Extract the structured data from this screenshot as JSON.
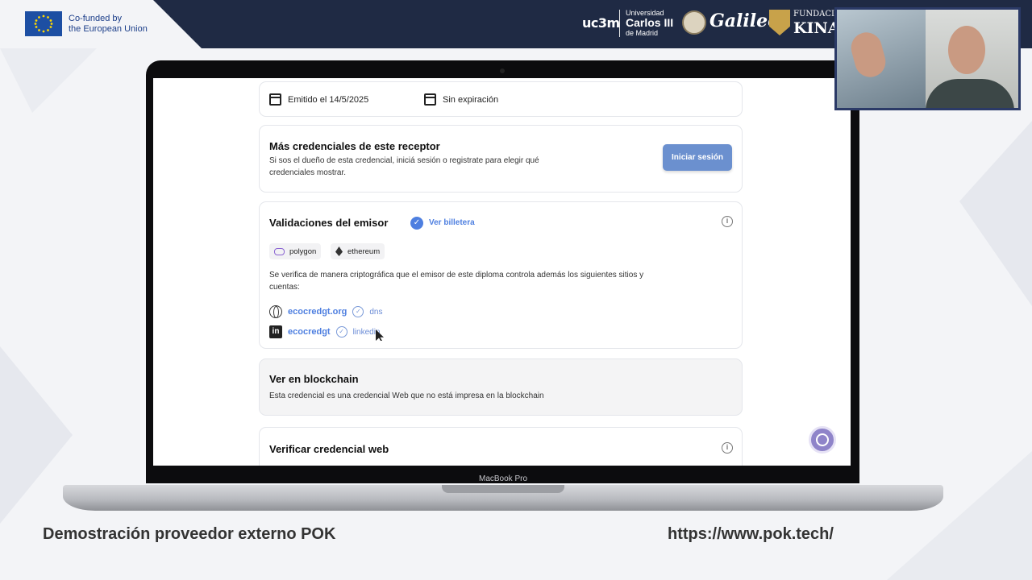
{
  "banner": {
    "eu_text_line1": "Co-funded by",
    "eu_text_line2": "the European Union",
    "uc3m_logo": "uc3m",
    "uc3m_line1": "Universidad",
    "uc3m_line2": "Carlos III",
    "uc3m_line3": "de Madrid",
    "galileo": "Galileo",
    "kinal_line1": "FUNDACIÓ",
    "kinal_line2": "KINAL",
    "colors": {
      "banner": "#1f2a44",
      "eu_flag": "#1d4fa3"
    }
  },
  "laptop": {
    "model_label": "MacBook Pro"
  },
  "credential_page": {
    "meta": {
      "issued": "Emitido el 14/5/2025",
      "expiration": "Sin expiración"
    },
    "more_credentials": {
      "title": "Más credenciales de este receptor",
      "text_line1": "Si sos el dueño de esta credencial, iniciá sesión o registrate para elegir qué",
      "text_line2": "credenciales mostrar.",
      "login_button": "Iniciar sesión"
    },
    "issuer_validations": {
      "title": "Validaciones del emisor",
      "wallet_link": "Ver billetera",
      "chains": [
        "polygon",
        "ethereum"
      ],
      "description_line1": "Se verifica de manera criptográfica que el emisor de este diploma controla además los siguientes sitios y",
      "description_line2": "cuentas:",
      "accounts": [
        {
          "name": "ecocredgt.org",
          "type": "dns",
          "icon": "globe-icon"
        },
        {
          "name": "ecocredgt",
          "type": "linkedin",
          "icon": "linkedin-icon"
        }
      ]
    },
    "blockchain": {
      "title": "Ver en blockchain",
      "text": "Esta credencial es una credencial Web que no está impresa en la blockchain"
    },
    "verify_web": {
      "title": "Verificar credencial web"
    },
    "colors": {
      "accent": "#4e7fe0",
      "button": "#6b90cf",
      "cookie": "#8f84c9"
    }
  },
  "captions": {
    "left": "Demostración proveedor externo POK",
    "right": "https://www.pok.tech/"
  }
}
